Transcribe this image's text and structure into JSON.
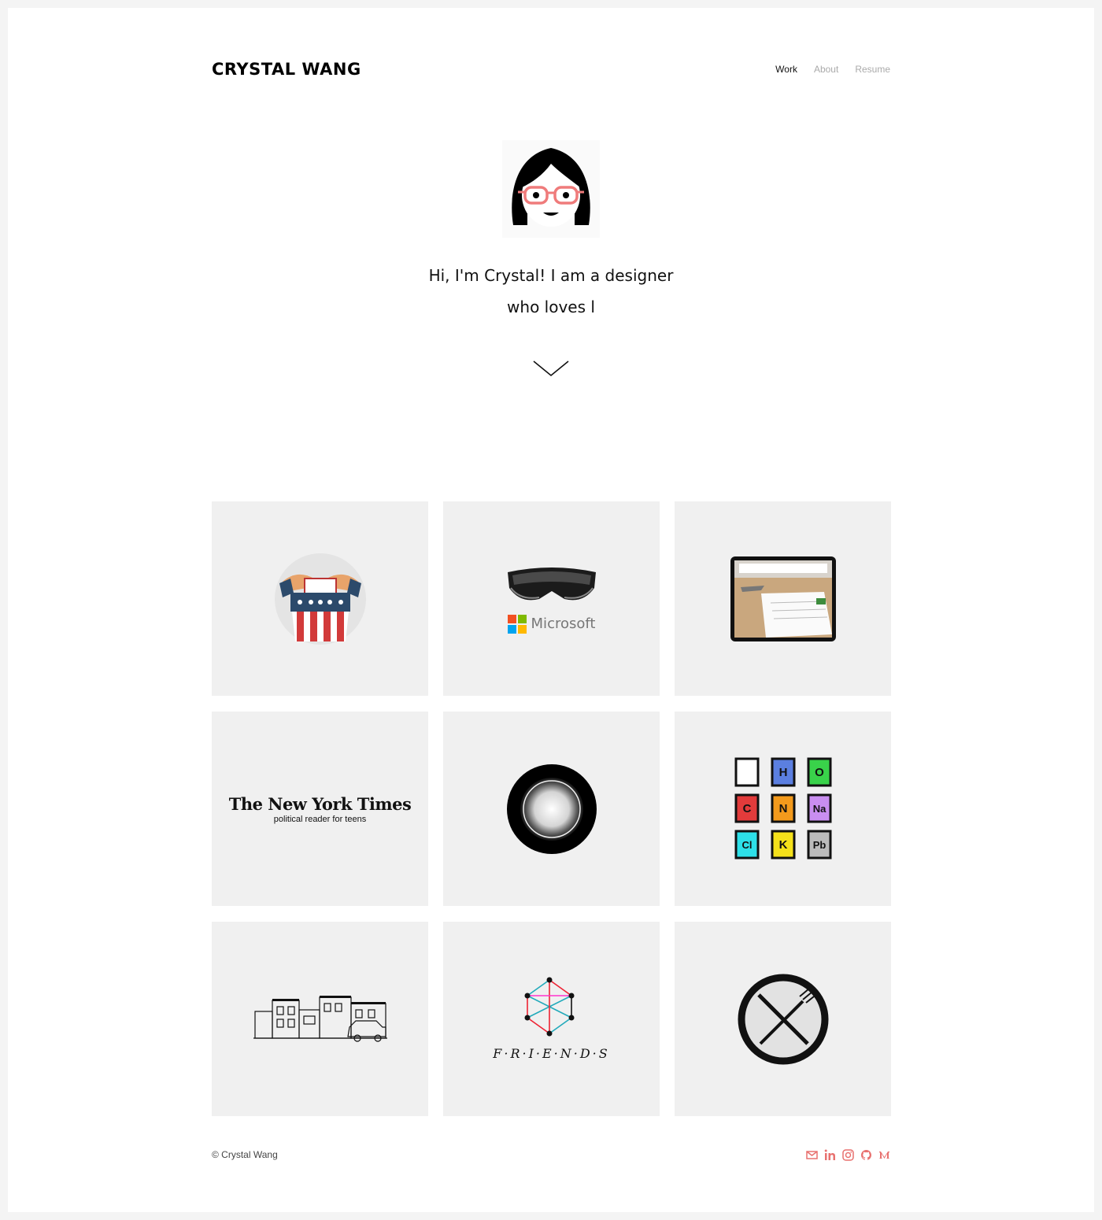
{
  "header": {
    "logo": "CRYSTAL WANG",
    "nav": [
      "Work",
      "About",
      "Resume"
    ]
  },
  "hero": {
    "line1": "Hi, I'm Crystal! I am a designer",
    "line2": "who loves l"
  },
  "projects": [
    {
      "icon": "ballot-box-icon"
    },
    {
      "icon": "hololens-icon",
      "brand": "Microsoft"
    },
    {
      "icon": "tablet-ar-icon"
    },
    {
      "icon": "nyt-logo",
      "title": "The New York Times",
      "subtitle": "political reader for teens"
    },
    {
      "icon": "ring-icon"
    },
    {
      "icon": "periodic-elements-icon",
      "elements": [
        "",
        "H",
        "O",
        "C",
        "N",
        "Na",
        "Cl",
        "K",
        "Pb"
      ]
    },
    {
      "icon": "street-sketch-icon"
    },
    {
      "icon": "friends-network-icon",
      "word": "F·R·I·E·N·D·S"
    },
    {
      "icon": "no-food-icon"
    }
  ],
  "footer": {
    "copyright": "© Crystal Wang",
    "social": [
      "mail-icon",
      "linkedin-icon",
      "instagram-icon",
      "github-icon",
      "medium-icon"
    ]
  },
  "colors": {
    "accent": "#e8716f",
    "tile_bg": "#f0f0f0"
  }
}
